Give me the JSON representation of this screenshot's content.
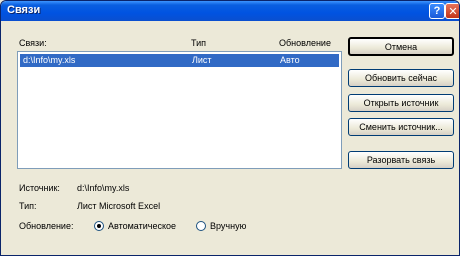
{
  "window": {
    "title": "Связи"
  },
  "list": {
    "headers": {
      "links": "Связи:",
      "type": "Тип",
      "update": "Обновление"
    },
    "rows": [
      {
        "source": "d:\\Info\\my.xls",
        "type": "Лист",
        "update": "Авто"
      }
    ]
  },
  "buttons": {
    "cancel": "Отмена",
    "update_now": "Обновить сейчас",
    "open_source": "Открыть источник",
    "change_source": "Сменить источник...",
    "break_link": "Разорвать связь"
  },
  "details": {
    "source_label": "Источник:",
    "source_value": "d:\\Info\\my.xls",
    "type_label": "Тип:",
    "type_value": "Лист Microsoft Excel",
    "update_label": "Обновление:",
    "auto_option": "Автоматическое",
    "manual_option": "Вручную",
    "selected": "auto"
  },
  "icons": {
    "help": "help-icon",
    "close": "close-icon"
  }
}
